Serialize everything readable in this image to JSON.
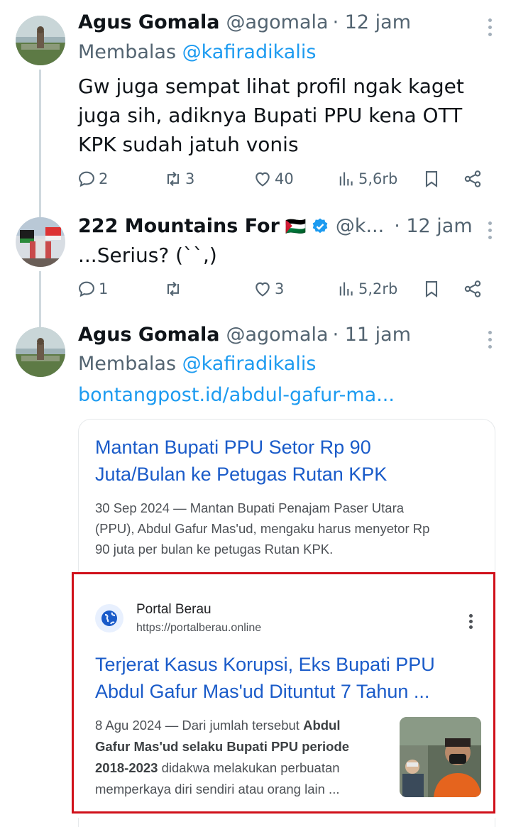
{
  "tweets": [
    {
      "name": "Agus Gomala",
      "handle": "@agomala",
      "time": "· 12 jam",
      "replying_prefix": "Membalas",
      "replying_to": "@kafiradikalis",
      "text_lines": [
        "Gw juga sempat lihat profil ngak kaget",
        "juga sih, adiknya Bupati PPU kena OTT",
        "KPK sudah jatuh vonis"
      ],
      "replies": "2",
      "retweets": "3",
      "likes": "40",
      "views": "5,6rb"
    },
    {
      "name": "222 Mountains For",
      "flag_emoji": "🇵🇸",
      "handle": "@k...",
      "time": "· 12 jam",
      "text": "...Serius? (``,)",
      "replies": "1",
      "retweets": "",
      "likes": "3",
      "views": "5,2rb"
    },
    {
      "name": "Agus Gomala",
      "handle": "@agomala",
      "time": "· 11 jam",
      "replying_prefix": "Membalas",
      "replying_to": "@kafiradikalis",
      "link": "bontangpost.id/abdul-gafur-ma..."
    }
  ],
  "card": {
    "title_lines": [
      "Mantan Bupati PPU Setor Rp 90",
      "Juta/Bulan ke Petugas Rutan KPK"
    ],
    "snippet_lines": [
      "30 Sep 2024 — Mantan Bupati Penajam Paser Utara",
      "(PPU), Abdul Gafur Mas'ud, mengaku harus menyetor Rp",
      "90 juta per bulan ke petugas Rutan KPK."
    ]
  },
  "result": {
    "site_name": "Portal Berau",
    "site_url": "https://portalberau.online",
    "title_lines": [
      "Terjerat Kasus Korupsi, Eks Bupati PPU",
      "Abdul Gafur Mas'ud Dituntut 7 Tahun ..."
    ],
    "snippet_date": "8 Agu 2024 — Dari jumlah tersebut ",
    "snippet_bold1": "Abdul",
    "snippet_bold2": "Gafur Mas'ud selaku Bupati PPU periode",
    "snippet_bold3": "2018-2023",
    "snippet_rest1": " didakwa melakukan perbuatan",
    "snippet_rest2": "memperkaya diri sendiri atau orang lain ..."
  },
  "colors": {
    "link": "#1d9bf0",
    "result_title": "#1a5bc9",
    "highlight_border": "#d0101a",
    "verified": "#1d9bf0"
  }
}
